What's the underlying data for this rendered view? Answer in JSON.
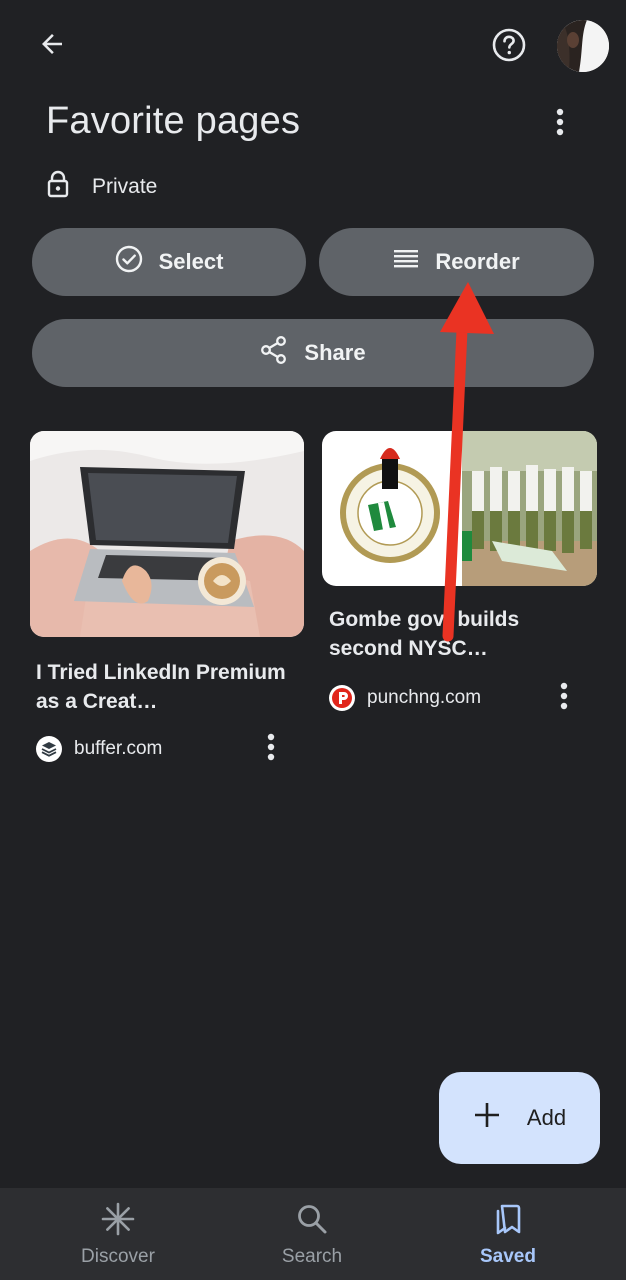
{
  "header": {
    "title": "Favorite pages",
    "visibility": "Private",
    "icons": {
      "back": "arrow-back-icon",
      "help": "help-circle-icon",
      "more": "more-vert-icon",
      "lock": "lock-icon"
    }
  },
  "actions": {
    "select_label": "Select",
    "reorder_label": "Reorder",
    "share_label": "Share"
  },
  "cards": [
    {
      "title": "I Tried LinkedIn Premium as a Creat…",
      "source": "buffer.com",
      "favicon": "buffer-logo-icon"
    },
    {
      "title": "Gombe govt builds second NYSC…",
      "source": "punchng.com",
      "favicon": "punch-logo-icon"
    }
  ],
  "fab": {
    "label": "Add",
    "icon": "plus-icon",
    "color": "#d3e3fd"
  },
  "bottom_nav": [
    {
      "label": "Discover",
      "icon": "asterisk-icon",
      "active": false
    },
    {
      "label": "Search",
      "icon": "search-icon",
      "active": false
    },
    {
      "label": "Saved",
      "icon": "bookmarks-icon",
      "active": true
    }
  ],
  "colors": {
    "background": "#202124",
    "pill": "#5f6368",
    "accent": "#a8c7fa",
    "annotation_arrow": "#ea3323"
  }
}
